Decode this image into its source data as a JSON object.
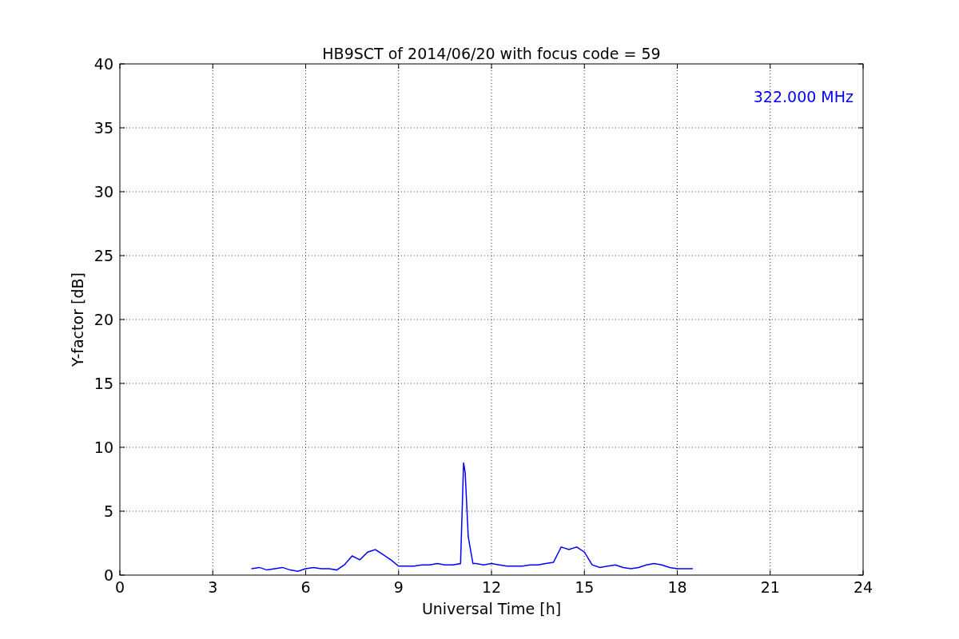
{
  "chart_data": {
    "type": "line",
    "title": "HB9SCT of 2014/06/20 with focus code = 59",
    "xlabel": "Universal Time [h]",
    "ylabel": "Y-factor [dB]",
    "xlim": [
      0,
      24
    ],
    "ylim": [
      0,
      40
    ],
    "xticks": [
      0,
      3,
      6,
      9,
      12,
      15,
      18,
      21,
      24
    ],
    "yticks": [
      0,
      5,
      10,
      15,
      20,
      25,
      30,
      35,
      40
    ],
    "x": [
      4.25,
      4.5,
      4.75,
      5,
      5.25,
      5.5,
      5.75,
      6,
      6.25,
      6.5,
      6.75,
      7,
      7.25,
      7.5,
      7.75,
      8,
      8.25,
      8.5,
      8.75,
      9,
      9.25,
      9.5,
      9.75,
      10,
      10.25,
      10.5,
      10.75,
      11,
      11.1,
      11.15,
      11.25,
      11.4,
      11.5,
      11.75,
      12,
      12.25,
      12.5,
      12.75,
      13,
      13.25,
      13.5,
      13.75,
      14,
      14.25,
      14.5,
      14.75,
      15,
      15.25,
      15.5,
      15.75,
      16,
      16.25,
      16.5,
      16.75,
      17,
      17.25,
      17.5,
      17.75,
      18,
      18.25,
      18.5
    ],
    "series": [
      {
        "name": "322.000 MHz",
        "color": "#0000ff",
        "values": [
          0.5,
          0.6,
          0.4,
          0.5,
          0.6,
          0.4,
          0.3,
          0.5,
          0.6,
          0.5,
          0.5,
          0.4,
          0.8,
          1.5,
          1.2,
          1.8,
          2.0,
          1.6,
          1.2,
          0.7,
          0.7,
          0.7,
          0.8,
          0.8,
          0.9,
          0.8,
          0.8,
          0.9,
          8.8,
          8.0,
          3.0,
          0.9,
          0.9,
          0.8,
          0.9,
          0.8,
          0.7,
          0.7,
          0.7,
          0.8,
          0.8,
          0.9,
          1.0,
          2.2,
          2.0,
          2.2,
          1.8,
          0.8,
          0.6,
          0.7,
          0.8,
          0.6,
          0.5,
          0.6,
          0.8,
          0.9,
          0.8,
          0.6,
          0.5,
          0.5,
          0.5
        ]
      }
    ],
    "grid": true
  }
}
